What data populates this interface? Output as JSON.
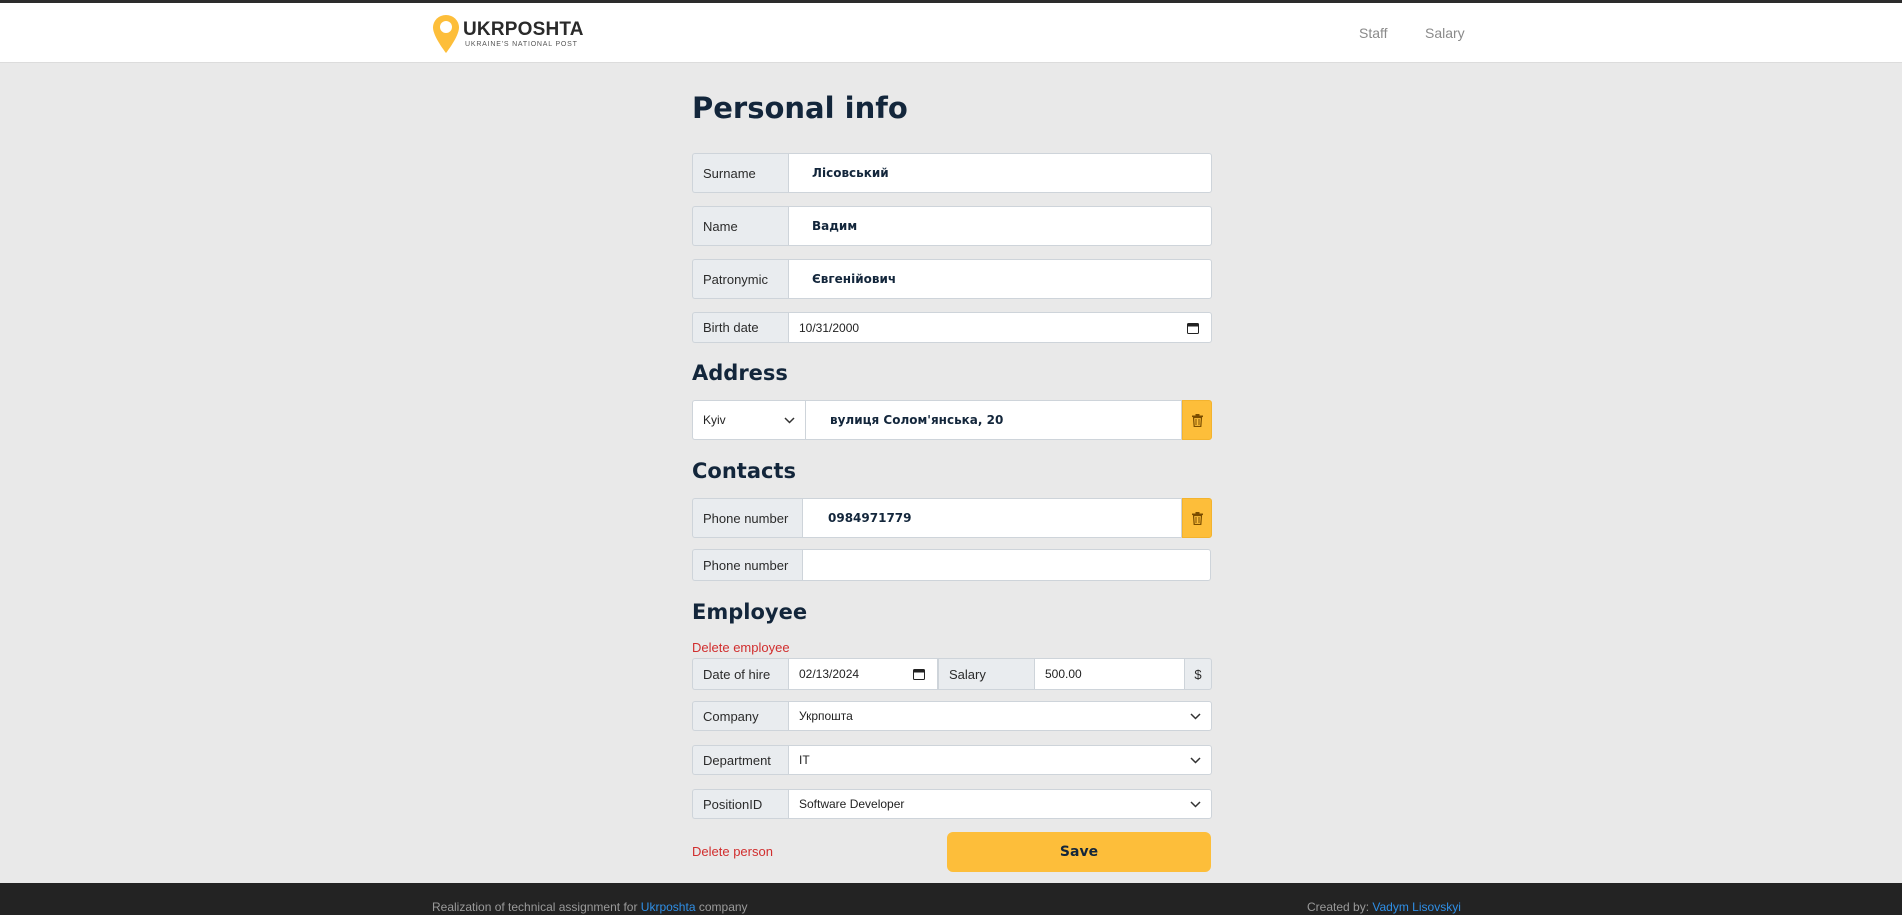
{
  "header": {
    "logo_title": "UKRPOSHTA",
    "logo_subtitle": "UKRAINE'S NATIONAL POST",
    "nav": [
      {
        "label": "Staff"
      },
      {
        "label": "Salary"
      }
    ]
  },
  "page": {
    "title": "Personal info"
  },
  "personal": {
    "surname_label": "Surname",
    "surname_value": "Лісовський",
    "name_label": "Name",
    "name_value": "Вадим",
    "patronymic_label": "Patronymic",
    "patronymic_value": "Євгенійович",
    "birth_label": "Birth date",
    "birth_value": "10/31/2000"
  },
  "address": {
    "heading": "Address",
    "city": "Kyiv",
    "street": "вулиця Солом'янська, 20"
  },
  "contacts": {
    "heading": "Contacts",
    "phones": [
      {
        "label": "Phone number",
        "value": "0984971779"
      },
      {
        "label": "Phone number",
        "value": ""
      }
    ]
  },
  "employee": {
    "heading": "Employee",
    "delete_label": "Delete employee",
    "hire_label": "Date of hire",
    "hire_value": "02/13/2024",
    "salary_label": "Salary",
    "salary_value": "500.00",
    "currency": "$",
    "company_label": "Company",
    "company_value": "Укрпошта",
    "department_label": "Department",
    "department_value": "IT",
    "position_label": "PositionID",
    "position_value": "Software Developer"
  },
  "actions": {
    "delete_person": "Delete person",
    "save": "Save"
  },
  "footer": {
    "left_prefix": "Realization of technical assignment for",
    "left_link": "Ukrposhta",
    "left_suffix": "company",
    "right_prefix": "Created by:",
    "right_link": "Vadym Lisovskyi"
  },
  "colors": {
    "accent": "#fdbe3a",
    "danger": "#d12e2e",
    "heading": "#13263b",
    "link": "#2f8fe6"
  }
}
